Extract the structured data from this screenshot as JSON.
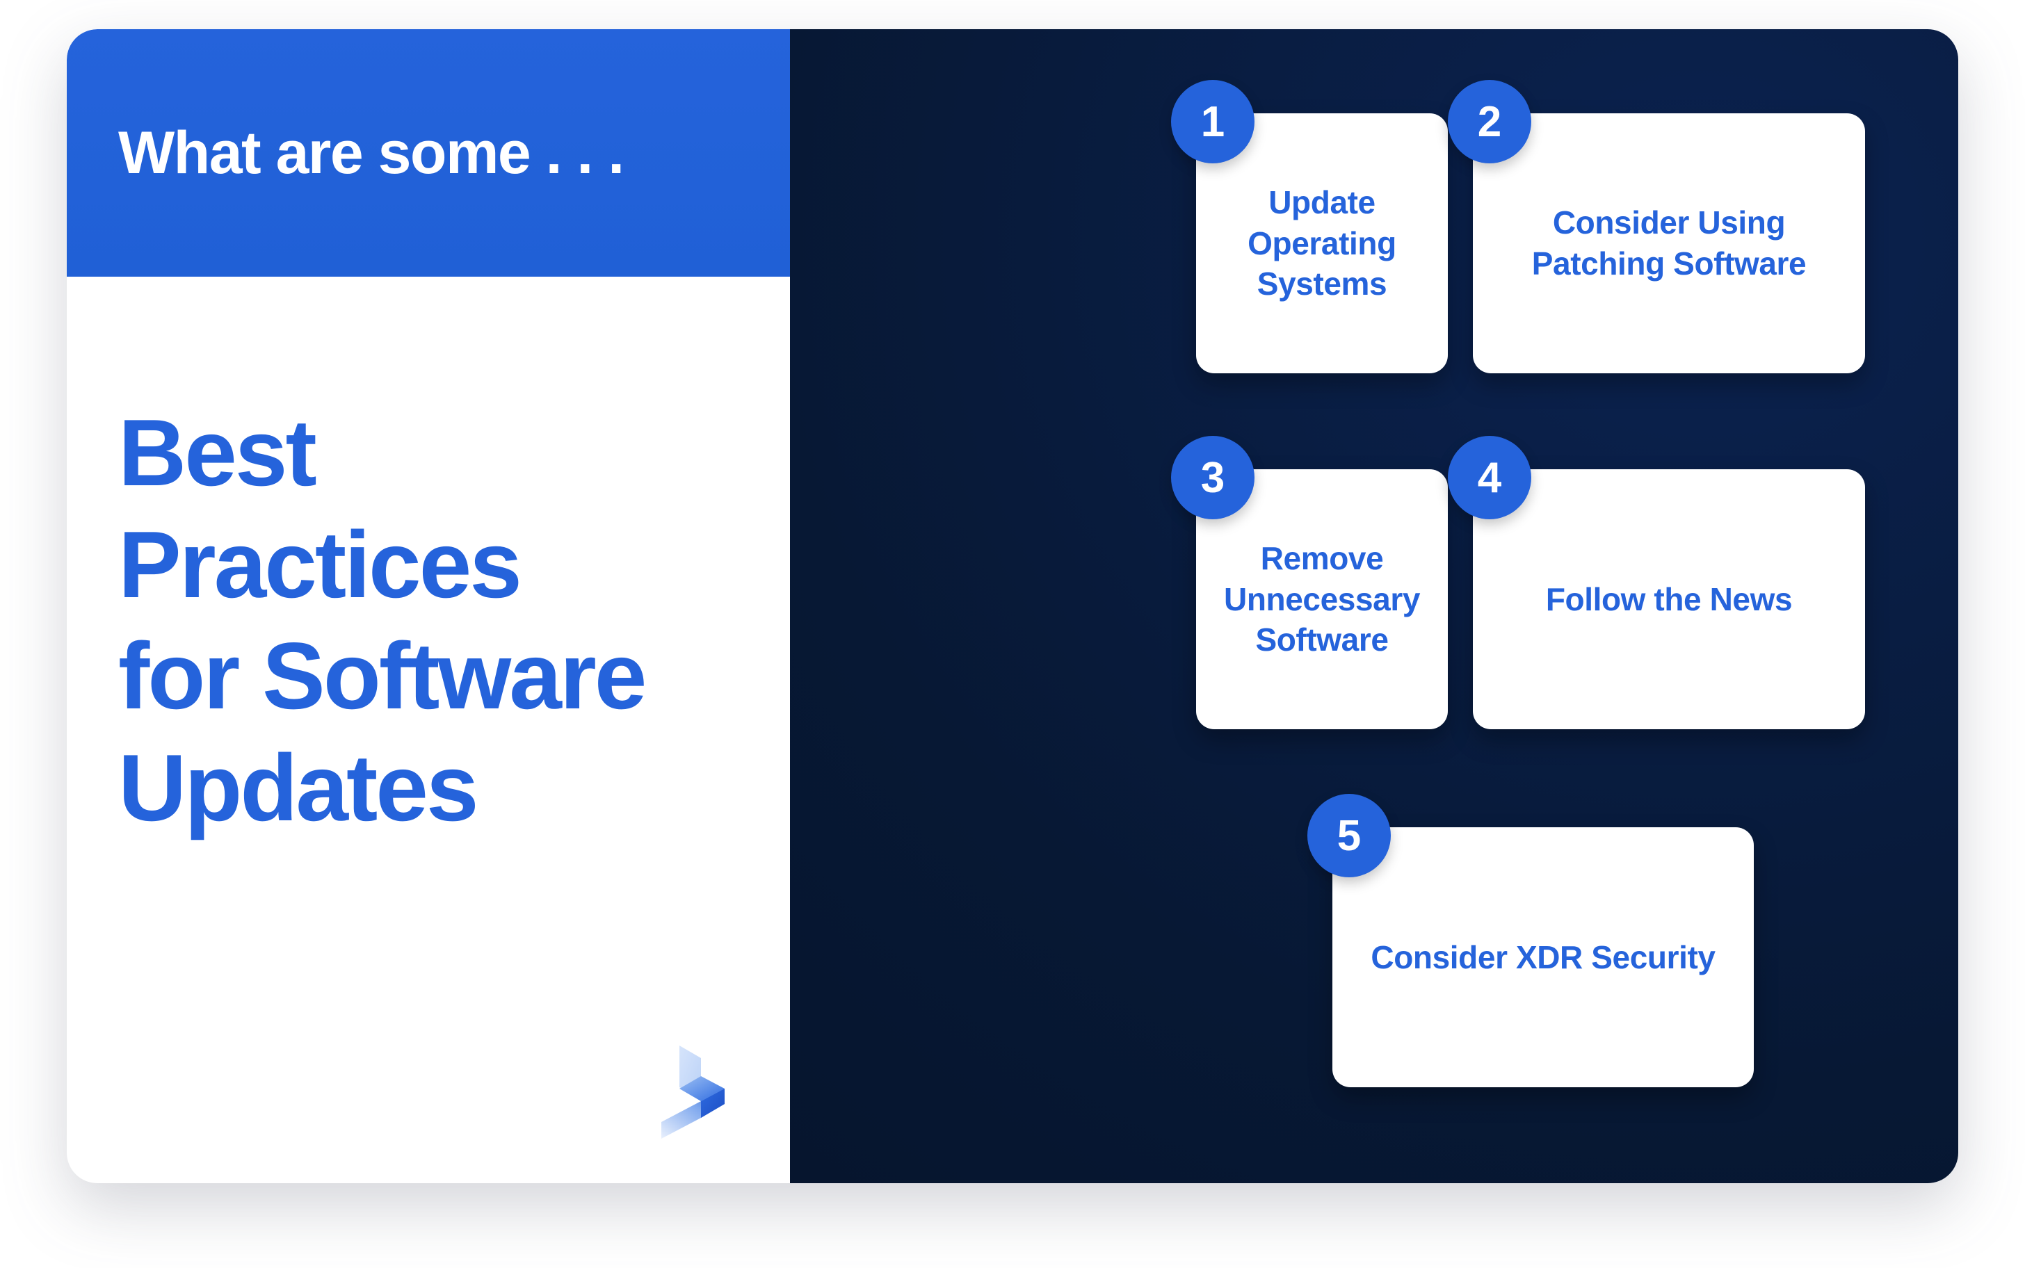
{
  "left": {
    "eyebrow": "What are some . . .",
    "headline_lines": [
      "Best",
      "Practices",
      "for Software",
      "Updates"
    ],
    "logo": "brand-logo-icon"
  },
  "cards": [
    {
      "number": "1",
      "title": "Update Operating Systems"
    },
    {
      "number": "2",
      "title": "Consider Using Patching Software"
    },
    {
      "number": "3",
      "title": "Remove Unnecessary Software"
    },
    {
      "number": "4",
      "title": "Follow the News"
    },
    {
      "number": "5",
      "title": "Consider XDR Security"
    }
  ],
  "colors": {
    "brand_blue": "#2563DB",
    "navy": "#071834",
    "card_white": "#FFFFFF",
    "page_background": "#FFFFFF"
  }
}
